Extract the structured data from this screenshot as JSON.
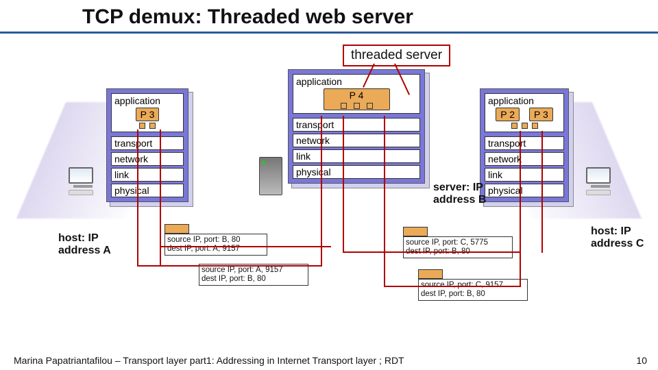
{
  "title": "TCP demux: Threaded web server",
  "callout": "threaded server",
  "layers": {
    "app": "application",
    "trans": "transport",
    "net": "network",
    "link": "link",
    "phys": "physical"
  },
  "procs": {
    "p2": "P 2",
    "p3": "P 3",
    "p4": "P 4"
  },
  "hosts": {
    "a": "host: IP address A",
    "c": "host: IP address C"
  },
  "serverLabel": "server: IP address B",
  "packets": {
    "ba": {
      "src": "source IP, port: B, 80",
      "dst": "dest IP, port: A, 9157"
    },
    "ab": {
      "src": "source IP, port: A, 9157",
      "dst": "dest IP, port: B, 80"
    },
    "cb1": {
      "src": "source IP, port: C, 5775",
      "dst": "dest IP, port: B, 80"
    },
    "cb2": {
      "src": "source IP, port: C, 9157",
      "dst": "dest IP, port: B, 80"
    }
  },
  "footer": {
    "text": "Marina Papatriantafilou –  Transport layer part1: Addressing in Internet Transport layer ; RDT",
    "page": "10"
  }
}
